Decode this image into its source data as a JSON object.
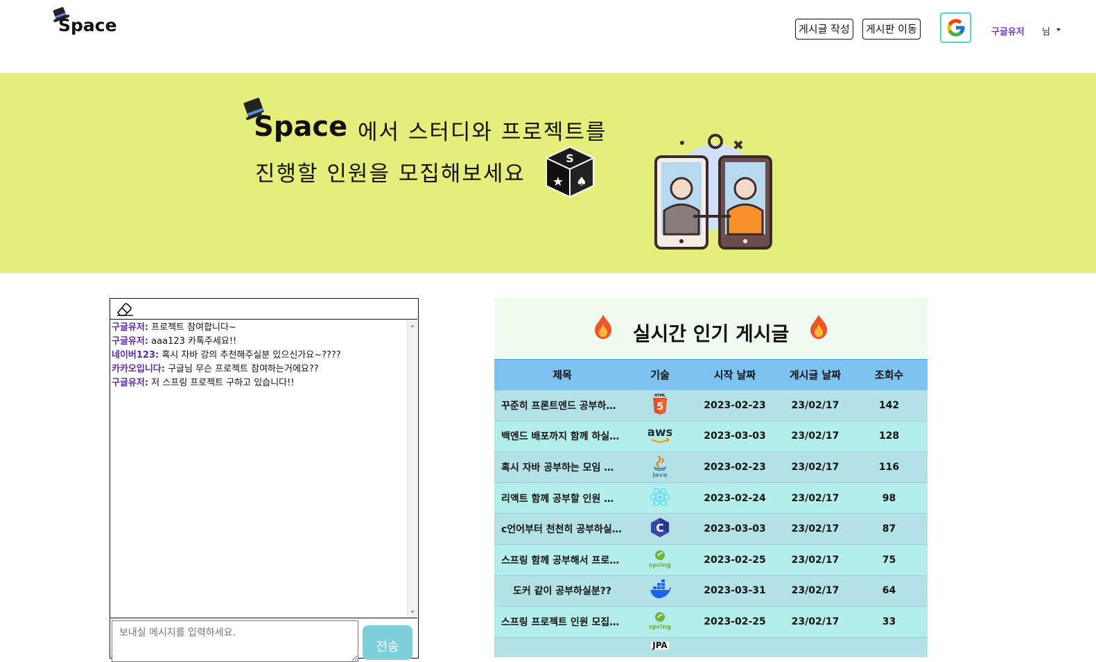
{
  "header": {
    "logo_text": "Space",
    "write_post_label": "게시글 작성",
    "go_board_label": "게시판 이동",
    "user_name": "구글유저",
    "user_suffix": "님"
  },
  "banner": {
    "logo_text": "Space",
    "line1": "에서 스터디와 프로젝트를",
    "line2": "진행할 인원을 모집해보세요"
  },
  "chat": {
    "messages": [
      {
        "who": "구글유저:",
        "text": " 프로젝트 참여합니다~"
      },
      {
        "who": "구글유저:",
        "text": " aaa123 카톡주세요!!"
      },
      {
        "who": "네이버123:",
        "text": " 혹시 자바 강의 추천해주실분 있으신가요~????"
      },
      {
        "who": "카카오입니다:",
        "text": " 구글님 무슨 프로젝트 참여하는거에요??"
      },
      {
        "who": "구글유저:",
        "text": " 저 스프링 프로젝트 구하고 있습니다!!"
      }
    ],
    "input_placeholder": "보내실 메시지를 입력하세요.",
    "send_label": "전송"
  },
  "popular": {
    "title": "실시간 인기 게시글",
    "columns": [
      "제목",
      "기술",
      "시작 날짜",
      "게시글 날짜",
      "조회수"
    ],
    "rows": [
      {
        "title": "꾸준히 프론트엔드 공부하…",
        "tech": "html5",
        "start": "2023-02-23",
        "posted": "23/02/17",
        "views": "142"
      },
      {
        "title": "백엔드 배포까지 함께 하실…",
        "tech": "aws",
        "start": "2023-03-03",
        "posted": "23/02/17",
        "views": "128"
      },
      {
        "title": "혹시 자바 공부하는 모임 …",
        "tech": "java",
        "start": "2023-02-23",
        "posted": "23/02/17",
        "views": "116"
      },
      {
        "title": "리액트 함께 공부할 인원 …",
        "tech": "react",
        "start": "2023-02-24",
        "posted": "23/02/17",
        "views": "98"
      },
      {
        "title": "c언어부터 천천히 공부하실…",
        "tech": "c",
        "start": "2023-03-03",
        "posted": "23/02/17",
        "views": "87"
      },
      {
        "title": "스프링 함께 공부해서 프로…",
        "tech": "spring",
        "start": "2023-02-25",
        "posted": "23/02/17",
        "views": "75"
      },
      {
        "title": "도커 같이 공부하실분??",
        "tech": "docker",
        "start": "2023-03-31",
        "posted": "23/02/17",
        "views": "64"
      },
      {
        "title": "스프링 프로젝트 인원 모집…",
        "tech": "spring",
        "start": "2023-02-25",
        "posted": "23/02/17",
        "views": "33"
      },
      {
        "title": "",
        "tech": "jpa",
        "start": "",
        "posted": "",
        "views": ""
      }
    ],
    "tech_labels": {
      "html5": "HTML",
      "aws": "aws",
      "java": "Java",
      "spring": "spring",
      "jpa": "JPA"
    }
  }
}
